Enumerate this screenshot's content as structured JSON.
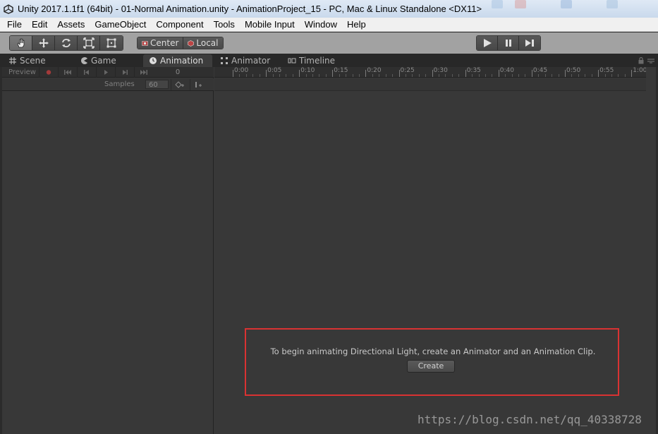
{
  "window": {
    "title": "Unity 2017.1.1f1 (64bit) - 01-Normal Animation.unity - AnimationProject_15 - PC, Mac & Linux Standalone <DX11>"
  },
  "menu": [
    "File",
    "Edit",
    "Assets",
    "GameObject",
    "Component",
    "Tools",
    "Mobile Input",
    "Window",
    "Help"
  ],
  "toolbar": {
    "tools": [
      "hand-tool-icon",
      "move-tool-icon",
      "rotate-tool-icon",
      "scale-tool-icon",
      "rect-tool-icon"
    ],
    "pivot_center": "Center",
    "pivot_local": "Local"
  },
  "tabs": {
    "scene": "Scene",
    "game": "Game",
    "animation": "Animation",
    "animator": "Animator",
    "timeline": "Timeline"
  },
  "animation": {
    "preview_label": "Preview",
    "frame": "0",
    "samples_label": "Samples",
    "samples_value": "60",
    "ticks": [
      "0:00",
      "0:05",
      "0:10",
      "0:15",
      "0:20",
      "0:25",
      "0:30",
      "0:35",
      "0:40",
      "0:45",
      "0:50",
      "0:55",
      "1:00"
    ],
    "message": "To begin animating Directional Light, create an Animator and an Animation Clip.",
    "create_label": "Create"
  },
  "watermark": "https://blog.csdn.net/qq_40338728",
  "colors": {
    "highlight": "#d93232",
    "record": "#a33a3a",
    "panel": "#383838"
  }
}
